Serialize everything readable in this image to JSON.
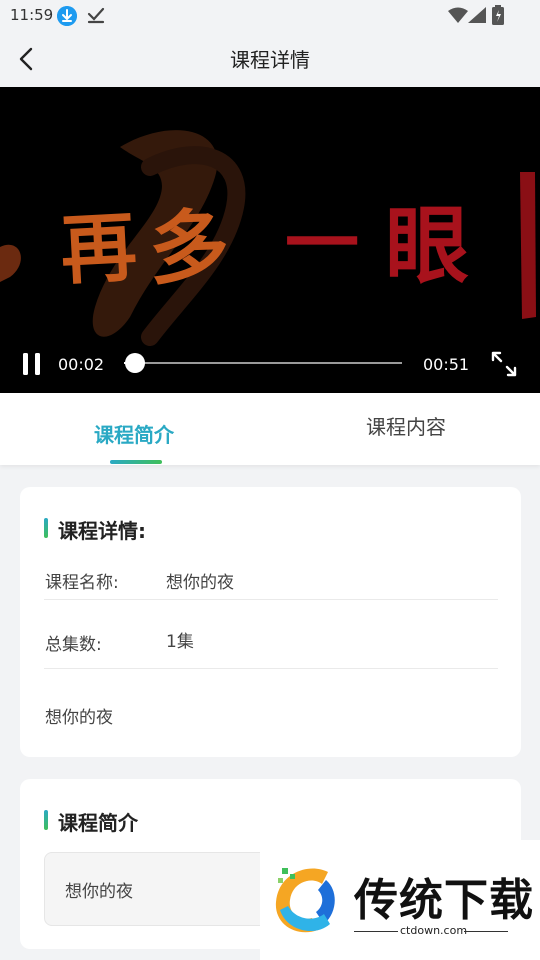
{
  "status_bar": {
    "time": "11:59",
    "icons": [
      "download-icon",
      "check-icon",
      "wifi-icon",
      "signal-icon",
      "battery-icon"
    ]
  },
  "header": {
    "title": "课程详情",
    "back_icon": "chevron-left-icon"
  },
  "player": {
    "artwork_text": "再多一眼",
    "current_time": "00:02",
    "total_time": "00:51",
    "progress_fraction": 0.04,
    "state": "playing",
    "icons": [
      "pause-icon",
      "fullscreen-icon"
    ]
  },
  "tabs": [
    {
      "label": "课程简介",
      "active": true
    },
    {
      "label": "课程内容",
      "active": false
    }
  ],
  "details_card": {
    "title": "课程详情:",
    "course_name_label": "课程名称:",
    "course_name_value": "想你的夜",
    "episodes_label": "总集数:",
    "episodes_value": "1集",
    "description": "想你的夜"
  },
  "intro_card": {
    "title": "课程简介",
    "text": "想你的夜"
  },
  "watermark": {
    "brand": "传统下载",
    "domain": "ctdown.com"
  },
  "colors": {
    "accent": "#2aa9c4",
    "accent_green": "#3fbf5a",
    "background": "#f2f3f5"
  }
}
